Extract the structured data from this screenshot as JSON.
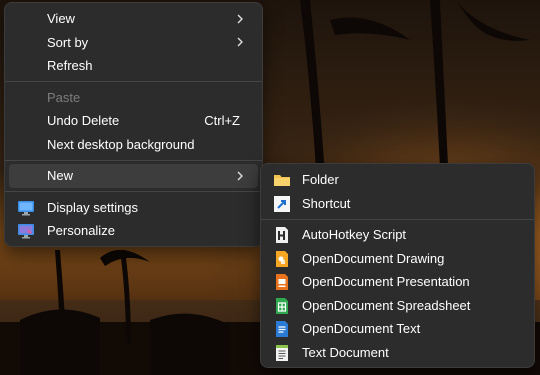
{
  "main_menu": {
    "view": "View",
    "sort_by": "Sort by",
    "refresh": "Refresh",
    "paste": "Paste",
    "undo_delete": "Undo Delete",
    "undo_shortcut": "Ctrl+Z",
    "next_background": "Next desktop background",
    "new": "New",
    "display_settings": "Display settings",
    "personalize": "Personalize"
  },
  "new_submenu": {
    "folder": "Folder",
    "shortcut": "Shortcut",
    "items": [
      {
        "label": "AutoHotkey Script",
        "icon": "autohotkey-script-icon"
      },
      {
        "label": "OpenDocument Drawing",
        "icon": "opendocument-drawing-icon"
      },
      {
        "label": "OpenDocument Presentation",
        "icon": "opendocument-presentation-icon"
      },
      {
        "label": "OpenDocument Spreadsheet",
        "icon": "opendocument-spreadsheet-icon"
      },
      {
        "label": "OpenDocument Text",
        "icon": "opendocument-text-icon"
      },
      {
        "label": "Text Document",
        "icon": "text-document-icon"
      }
    ]
  },
  "colors": {
    "menu_bg": "#2c2c2c",
    "hover_bg": "#3d3d3d",
    "folder": "#f2c14e",
    "drawing": "#f5a623",
    "presentation": "#e8731c",
    "spreadsheet": "#2fa84f",
    "text": "#2a7bd5"
  }
}
